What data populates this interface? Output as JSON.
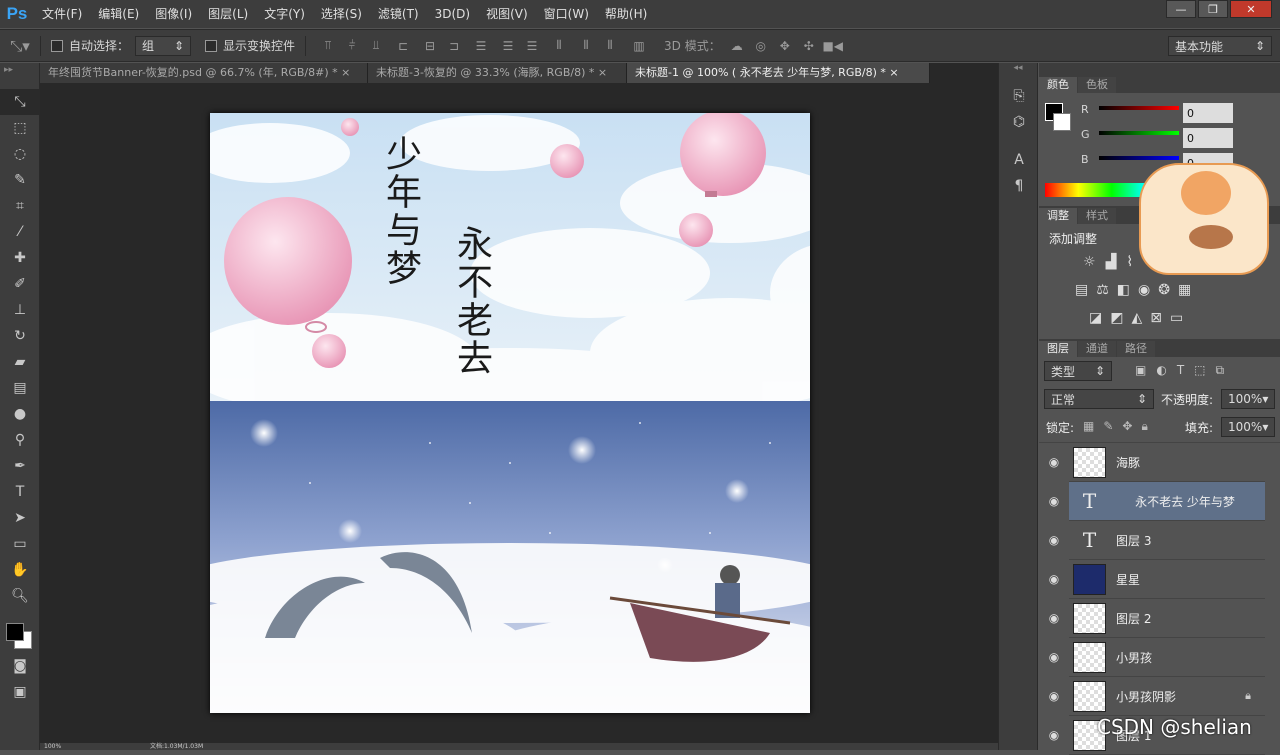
{
  "app": {
    "logo": "Ps"
  },
  "menu": [
    "文件(F)",
    "编辑(E)",
    "图像(I)",
    "图层(L)",
    "文字(Y)",
    "选择(S)",
    "滤镜(T)",
    "3D(D)",
    "视图(V)",
    "窗口(W)",
    "帮助(H)"
  ],
  "window_controls": {
    "minimize": "—",
    "restore": "❐",
    "close": "✕"
  },
  "options": {
    "auto_select_label": "自动选择：",
    "auto_select_value": "组",
    "show_transform_label": "显示变换控件",
    "mode3d_label": "3D 模式：",
    "workspace": "基本功能"
  },
  "tabs": [
    {
      "label": "年终囤货节Banner-恢复的.psd @ 66.7% (年, RGB/8#) *",
      "close": "×"
    },
    {
      "label": "未标题-3-恢复的 @ 33.3% (海豚, RGB/8) *",
      "close": "×"
    },
    {
      "label": "未标题-1 @ 100% (     永不老去 少年与梦, RGB/8) *",
      "close": "×",
      "active": true
    }
  ],
  "artwork": {
    "title_left": "少年与梦",
    "title_right": "永不老去"
  },
  "color_panel": {
    "tabs": [
      "颜色",
      "色板"
    ],
    "r_label": "R",
    "r_value": "0",
    "g_label": "G",
    "g_value": "0",
    "b_label": "B",
    "b_value": "0"
  },
  "adjust_panel": {
    "tabs": [
      "调整",
      "样式"
    ],
    "add_label": "添加调整"
  },
  "layers_panel": {
    "tabs": [
      "图层",
      "通道",
      "路径"
    ],
    "filter_type": "类型",
    "blend_mode": "正常",
    "opacity_label": "不透明度:",
    "opacity_value": "100%",
    "lock_label": "锁定:",
    "fill_label": "填充:",
    "fill_value": "100%",
    "layers": [
      {
        "name": "海豚",
        "kind": "pixel"
      },
      {
        "name": "     永不老去 少年与梦",
        "kind": "text",
        "selected": true
      },
      {
        "name": "图层 3",
        "kind": "text"
      },
      {
        "name": "星星",
        "kind": "pixel-dark"
      },
      {
        "name": "图层 2",
        "kind": "pixel"
      },
      {
        "name": "小男孩",
        "kind": "pixel"
      },
      {
        "name": "小男孩阴影",
        "kind": "pixel",
        "locked": true
      },
      {
        "name": "图层 1",
        "kind": "pixel"
      }
    ]
  },
  "status": {
    "zoom": "100%",
    "doc": "文档:1.03M/1.03M"
  },
  "watermark": "CSDN @shelian",
  "colors": {
    "accent": "#3aa4f6",
    "panel_bg": "#535353",
    "selected_layer": "#5f7089"
  }
}
